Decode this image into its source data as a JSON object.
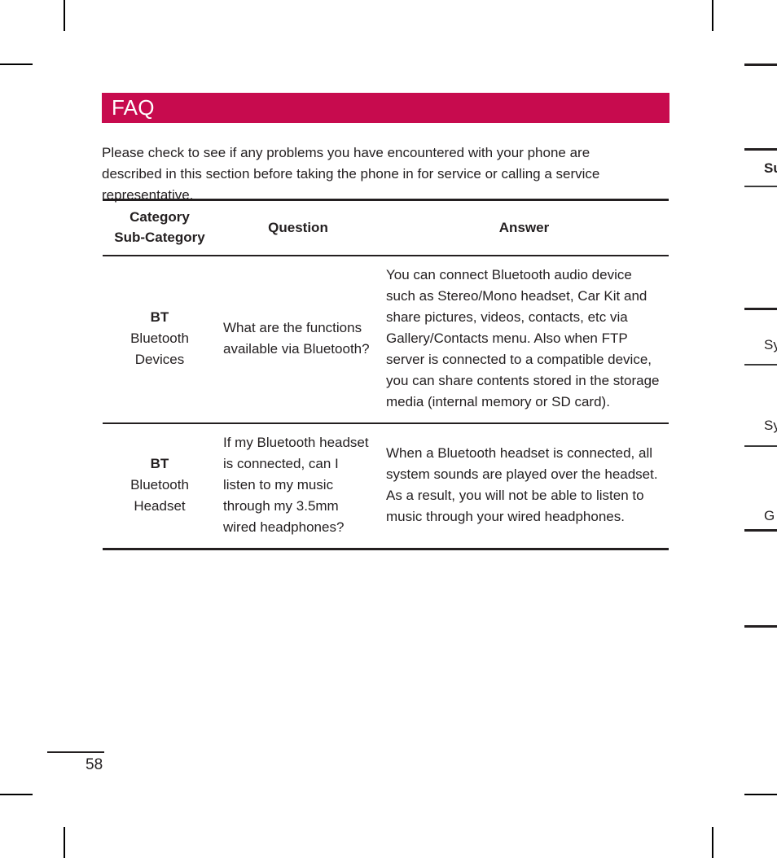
{
  "document": {
    "page_number": "58"
  },
  "banner": {
    "title": "FAQ",
    "color": "#c70b4e"
  },
  "intro": {
    "text": "Please check to see if any problems you have encountered with your phone are described in this section before taking the phone in for service or calling a service representative."
  },
  "table": {
    "headers": {
      "category": "Category",
      "sub_category": "Sub-Category",
      "question": "Question",
      "answer": "Answer"
    },
    "rows": [
      {
        "category_main": "BT",
        "category_sub_line1": "Bluetooth",
        "category_sub_line2": "Devices",
        "question": "What are the functions available via Bluetooth?",
        "answer": "You can connect Bluetooth audio device such as Stereo/Mono headset, Car Kit and share pictures, videos, contacts, etc via Gallery/Contacts menu. Also when FTP server is connected to a compatible device, you can share contents stored in the storage media (internal memory or SD card)."
      },
      {
        "category_main": "BT",
        "category_sub_line1": "Bluetooth",
        "category_sub_line2": "Headset",
        "question": "If my Bluetooth headset is connected, can I listen to my music through my 3.5mm wired headphones?",
        "answer": "When a Bluetooth headset is connected, all system sounds are played over the headset. As a result, you will not be able to listen to music through your wired headphones."
      }
    ]
  },
  "side_index": {
    "tabs": [
      {
        "label": "Su",
        "active": true
      },
      {
        "label": "Sy",
        "active": false
      },
      {
        "label": "Sy",
        "active": false
      },
      {
        "label": "G",
        "active": false
      }
    ]
  }
}
